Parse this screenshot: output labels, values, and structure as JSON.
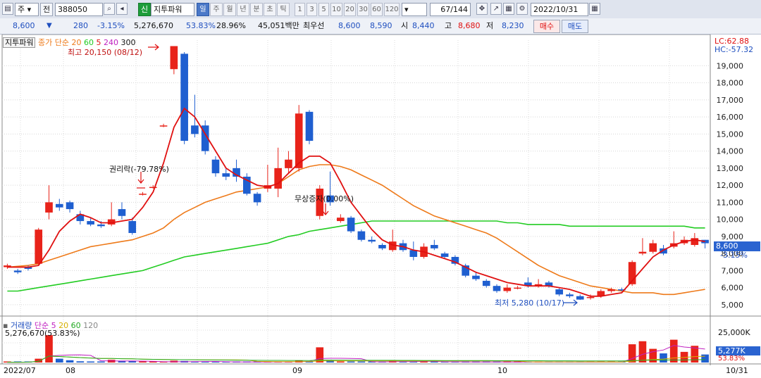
{
  "toolbar": {
    "market": "주",
    "prev_label": "전",
    "code": "388050",
    "indicator_badge": "신",
    "indicator_name": "지투파워",
    "periods": [
      "일",
      "주",
      "월",
      "년",
      "분",
      "초",
      "틱"
    ],
    "active_period": "일",
    "intervals": [
      "1",
      "3",
      "5",
      "10",
      "20",
      "30",
      "60",
      "120"
    ],
    "page_value": "67",
    "page_total": "/144",
    "date": "2022/10/31"
  },
  "quote": {
    "price": "8,600",
    "change": "280",
    "change_rate": "-3.15%",
    "volume": "5,276,670",
    "vol_ratio": "53.83%",
    "turnover": "28.96%",
    "amount": "45,051백만",
    "best_label": "최우선",
    "ask": "8,600",
    "bid": "8,590",
    "open_label": "시",
    "open": "8,440",
    "high_label": "고",
    "high": "8,680",
    "close_label": "저",
    "low": "8,230",
    "buy_label": "매수",
    "sell_label": "매도"
  },
  "legend": {
    "title": "지투파워",
    "ma_label": "종가 단순",
    "ma_periods": [
      "20",
      "60",
      "5",
      "240",
      "300"
    ]
  },
  "annotations": {
    "high": "최고 20,150 (08/12)",
    "low": "최저 5,280 (10/17)",
    "rights": "권리락(-79.78%)",
    "bonus": "무상증자(0.00%)",
    "lc": "LC:62.88",
    "hc": "HC:-57.32",
    "price_tag": "8,600",
    "pct_tag": "-3.15%"
  },
  "volume_panel": {
    "title": "거래량",
    "ma_label": "단순",
    "ma_periods": [
      "5",
      "20",
      "60",
      "120"
    ],
    "value_line": "5,276,670(53.83%)",
    "scale_label": "25,000K",
    "tag": "5,277K",
    "pct": "53.83%"
  },
  "x_axis": {
    "start": "2022/07",
    "labels": [
      "08",
      "09",
      "10"
    ],
    "end": "10/31"
  },
  "colors": {
    "up": "#e8231a",
    "down": "#1f5fd0",
    "ma5": "#e01010",
    "ma20": "#ee7a1a",
    "ma60": "#22cc22",
    "ma120": "#8a8a8a"
  },
  "chart_data": {
    "type": "candlestick",
    "ylim": [
      4500,
      20500
    ],
    "y_ticks": [
      5000,
      6000,
      7000,
      8000,
      9000,
      10000,
      11000,
      12000,
      13000,
      14000,
      15000,
      16000,
      17000,
      18000,
      19000
    ],
    "candles": [
      {
        "o": 7200,
        "c": 7300,
        "h": 7400,
        "l": 7100,
        "v": 200
      },
      {
        "o": 7000,
        "c": 6900,
        "h": 7100,
        "l": 6800,
        "v": 150
      },
      {
        "o": 7200,
        "c": 7100,
        "h": 7300,
        "l": 7000,
        "v": 300
      },
      {
        "o": 7400,
        "c": 9400,
        "h": 9500,
        "l": 7300,
        "v": 2500
      },
      {
        "o": 10400,
        "c": 11000,
        "h": 12000,
        "l": 10000,
        "v": 18000
      },
      {
        "o": 10900,
        "c": 10700,
        "h": 11200,
        "l": 10500,
        "v": 2500
      },
      {
        "o": 11000,
        "c": 10600,
        "h": 11100,
        "l": 10400,
        "v": 1500
      },
      {
        "o": 10300,
        "c": 9900,
        "h": 10500,
        "l": 9700,
        "v": 800
      },
      {
        "o": 9900,
        "c": 9700,
        "h": 10100,
        "l": 9600,
        "v": 600
      },
      {
        "o": 9700,
        "c": 9600,
        "h": 9900,
        "l": 9500,
        "v": 500
      },
      {
        "o": 9700,
        "c": 10000,
        "h": 11000,
        "l": 9600,
        "v": 1800
      },
      {
        "o": 10600,
        "c": 10200,
        "h": 11000,
        "l": 10000,
        "v": 1200
      },
      {
        "o": 9900,
        "c": 9200,
        "h": 10100,
        "l": 9100,
        "v": 1000
      },
      {
        "o": 11500,
        "c": 11500,
        "h": 11600,
        "l": 11400,
        "v": 100
      },
      {
        "o": 11900,
        "c": 11900,
        "h": 12000,
        "l": 11800,
        "v": 100
      },
      {
        "o": 15500,
        "c": 15500,
        "h": 15600,
        "l": 15400,
        "v": 100
      },
      {
        "o": 18800,
        "c": 20150,
        "h": 20150,
        "l": 18500,
        "v": 1200
      },
      {
        "o": 19700,
        "c": 14600,
        "h": 19800,
        "l": 14400,
        "v": 1000
      },
      {
        "o": 15500,
        "c": 15000,
        "h": 17300,
        "l": 14800,
        "v": 500
      },
      {
        "o": 15500,
        "c": 14000,
        "h": 15800,
        "l": 13800,
        "v": 400
      },
      {
        "o": 13500,
        "c": 12700,
        "h": 13700,
        "l": 12500,
        "v": 400
      },
      {
        "o": 12700,
        "c": 12500,
        "h": 13000,
        "l": 12300,
        "v": 300
      },
      {
        "o": 13000,
        "c": 12500,
        "h": 13500,
        "l": 12200,
        "v": 400
      },
      {
        "o": 12500,
        "c": 11500,
        "h": 12700,
        "l": 11400,
        "v": 300
      },
      {
        "o": 11500,
        "c": 11000,
        "h": 11600,
        "l": 10800,
        "v": 300
      },
      {
        "o": 11800,
        "c": 12000,
        "h": 13200,
        "l": 11600,
        "v": 500
      },
      {
        "o": 11800,
        "c": 13000,
        "h": 14200,
        "l": 11300,
        "v": 600
      },
      {
        "o": 13000,
        "c": 13500,
        "h": 14000,
        "l": 12700,
        "v": 300
      },
      {
        "o": 13000,
        "c": 16200,
        "h": 16700,
        "l": 12800,
        "v": 1200
      },
      {
        "o": 16300,
        "c": 14600,
        "h": 16400,
        "l": 14400,
        "v": 800
      },
      {
        "o": 10200,
        "c": 11800,
        "h": 12000,
        "l": 10000,
        "v": 10000
      },
      {
        "o": 11400,
        "c": 11000,
        "h": 12800,
        "l": 10800,
        "v": 1500
      },
      {
        "o": 9900,
        "c": 10100,
        "h": 10300,
        "l": 9800,
        "v": 400
      },
      {
        "o": 10100,
        "c": 9300,
        "h": 10200,
        "l": 9200,
        "v": 400
      },
      {
        "o": 9300,
        "c": 8800,
        "h": 9400,
        "l": 8700,
        "v": 300
      },
      {
        "o": 8800,
        "c": 8700,
        "h": 9000,
        "l": 8600,
        "v": 200
      },
      {
        "o": 8500,
        "c": 8300,
        "h": 8600,
        "l": 8200,
        "v": 300
      },
      {
        "o": 8200,
        "c": 8700,
        "h": 9400,
        "l": 8100,
        "v": 1600
      },
      {
        "o": 8600,
        "c": 8200,
        "h": 8800,
        "l": 8100,
        "v": 500
      },
      {
        "o": 8200,
        "c": 7800,
        "h": 8700,
        "l": 7600,
        "v": 500
      },
      {
        "o": 7800,
        "c": 8400,
        "h": 8600,
        "l": 7700,
        "v": 700
      },
      {
        "o": 8500,
        "c": 8300,
        "h": 8800,
        "l": 8200,
        "v": 400
      },
      {
        "o": 8000,
        "c": 7800,
        "h": 8100,
        "l": 7700,
        "v": 300
      },
      {
        "o": 7800,
        "c": 7400,
        "h": 7900,
        "l": 7300,
        "v": 300
      },
      {
        "o": 7300,
        "c": 6700,
        "h": 7400,
        "l": 6600,
        "v": 400
      },
      {
        "o": 6700,
        "c": 6500,
        "h": 6900,
        "l": 6400,
        "v": 300
      },
      {
        "o": 6400,
        "c": 6100,
        "h": 6500,
        "l": 6000,
        "v": 400
      },
      {
        "o": 6100,
        "c": 5800,
        "h": 6200,
        "l": 5700,
        "v": 300
      },
      {
        "o": 5800,
        "c": 6000,
        "h": 6200,
        "l": 5700,
        "v": 300
      },
      {
        "o": 6000,
        "c": 6000,
        "h": 6100,
        "l": 5900,
        "v": 200
      },
      {
        "o": 6300,
        "c": 6100,
        "h": 6600,
        "l": 6000,
        "v": 400
      },
      {
        "o": 6100,
        "c": 6200,
        "h": 6500,
        "l": 6000,
        "v": 300
      },
      {
        "o": 6300,
        "c": 6100,
        "h": 6400,
        "l": 6000,
        "v": 300
      },
      {
        "o": 5900,
        "c": 5600,
        "h": 6000,
        "l": 5500,
        "v": 300
      },
      {
        "o": 5600,
        "c": 5500,
        "h": 5700,
        "l": 5400,
        "v": 200
      },
      {
        "o": 5500,
        "c": 5300,
        "h": 5600,
        "l": 5280,
        "v": 200
      },
      {
        "o": 5400,
        "c": 5450,
        "h": 5600,
        "l": 5300,
        "v": 200
      },
      {
        "o": 5500,
        "c": 5800,
        "h": 5900,
        "l": 5400,
        "v": 300
      },
      {
        "o": 5800,
        "c": 5900,
        "h": 6000,
        "l": 5700,
        "v": 300
      },
      {
        "o": 5900,
        "c": 5850,
        "h": 6000,
        "l": 5800,
        "v": 250
      },
      {
        "o": 6200,
        "c": 7500,
        "h": 7600,
        "l": 6100,
        "v": 12000
      },
      {
        "o": 8000,
        "c": 8100,
        "h": 8900,
        "l": 7900,
        "v": 14000
      },
      {
        "o": 8100,
        "c": 8600,
        "h": 8800,
        "l": 8000,
        "v": 9000
      },
      {
        "o": 8300,
        "c": 8000,
        "h": 8500,
        "l": 7900,
        "v": 6000
      },
      {
        "o": 8400,
        "c": 8600,
        "h": 9300,
        "l": 8300,
        "v": 15000
      },
      {
        "o": 8600,
        "c": 8800,
        "h": 9000,
        "l": 8500,
        "v": 7000
      },
      {
        "o": 8500,
        "c": 8900,
        "h": 9200,
        "l": 8400,
        "v": 11000
      },
      {
        "o": 8800,
        "c": 8600,
        "h": 8800,
        "l": 8300,
        "v": 5277
      }
    ],
    "ma5": [
      7200,
      7200,
      7200,
      7300,
      8200,
      9300,
      9900,
      10300,
      10100,
      9800,
      9800,
      9900,
      10000,
      10700,
      11600,
      13300,
      15400,
      16500,
      16000,
      15000,
      14000,
      13000,
      12600,
      12300,
      12000,
      11900,
      12100,
      12700,
      13300,
      13700,
      13700,
      13300,
      12200,
      11000,
      10200,
      9400,
      8800,
      8500,
      8400,
      8200,
      8100,
      7900,
      7700,
      7500,
      7200,
      6900,
      6700,
      6500,
      6300,
      6200,
      6100,
      6100,
      6100,
      6000,
      5900,
      5700,
      5500,
      5500,
      5600,
      5700,
      6400,
      7100,
      7800,
      8200,
      8500,
      8700,
      8800,
      8700
    ],
    "ma20": [
      7200,
      7250,
      7300,
      7400,
      7600,
      7800,
      8000,
      8200,
      8400,
      8500,
      8600,
      8700,
      8800,
      9000,
      9200,
      9500,
      10000,
      10400,
      10700,
      11000,
      11200,
      11400,
      11600,
      11700,
      11800,
      11900,
      12100,
      12500,
      12900,
      13100,
      13200,
      13200,
      13100,
      12900,
      12600,
      12300,
      12000,
      11600,
      11200,
      10800,
      10500,
      10200,
      10000,
      9800,
      9600,
      9400,
      9200,
      8900,
      8500,
      8100,
      7700,
      7300,
      7000,
      6700,
      6500,
      6300,
      6100,
      6000,
      5900,
      5800,
      5700,
      5700,
      5700,
      5600,
      5600,
      5700,
      5800,
      5900
    ],
    "ma60": [
      5800,
      5800,
      5900,
      6000,
      6100,
      6200,
      6300,
      6400,
      6500,
      6600,
      6700,
      6800,
      6900,
      7000,
      7200,
      7400,
      7600,
      7800,
      7900,
      8000,
      8100,
      8200,
      8300,
      8400,
      8500,
      8600,
      8800,
      9000,
      9100,
      9300,
      9400,
      9500,
      9600,
      9700,
      9800,
      9900,
      9900,
      9900,
      9900,
      9900,
      9900,
      9900,
      9900,
      9900,
      9900,
      9900,
      9900,
      9900,
      9800,
      9800,
      9700,
      9700,
      9700,
      9700,
      9600,
      9600,
      9600,
      9600,
      9600,
      9600,
      9600,
      9600,
      9600,
      9600,
      9600,
      9600,
      9500,
      9500
    ]
  }
}
